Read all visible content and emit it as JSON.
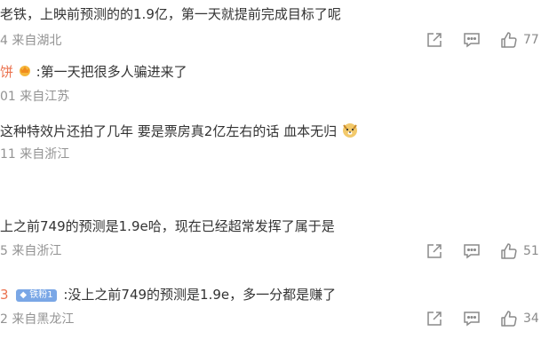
{
  "comments": [
    {
      "text": "老铁，上映前预测的的1.9亿，第一天就提前完成目标了呢",
      "meta": "4 来自湖北",
      "like_count": "77"
    },
    {
      "user": "饼",
      "text": ":第一天把很多人骗进来了",
      "meta": "01 来自江苏"
    },
    {
      "text": "这种特效片还拍了几年 要是票房真2亿左右的话 血本无归",
      "meta": "11 来自浙江",
      "emoji": "dog-face-emoji"
    },
    {
      "text": "上之前749的预测是1.9e哈，现在已经超常发挥了属于是",
      "meta": "5 来自浙江",
      "like_count": "51"
    },
    {
      "user": "3",
      "badge": "铁粉1",
      "text": ":没上之前749的预测是1.9e，多一分都是赚了",
      "meta": "2 来自黑龙江",
      "like_count": "34"
    }
  ],
  "icons": {
    "share": "share-icon",
    "comment": "comment-icon",
    "like": "like-icon"
  },
  "colors": {
    "text": "#333333",
    "meta": "#939393",
    "nickname": "#eb7350",
    "badge": "#7aa7e6"
  }
}
